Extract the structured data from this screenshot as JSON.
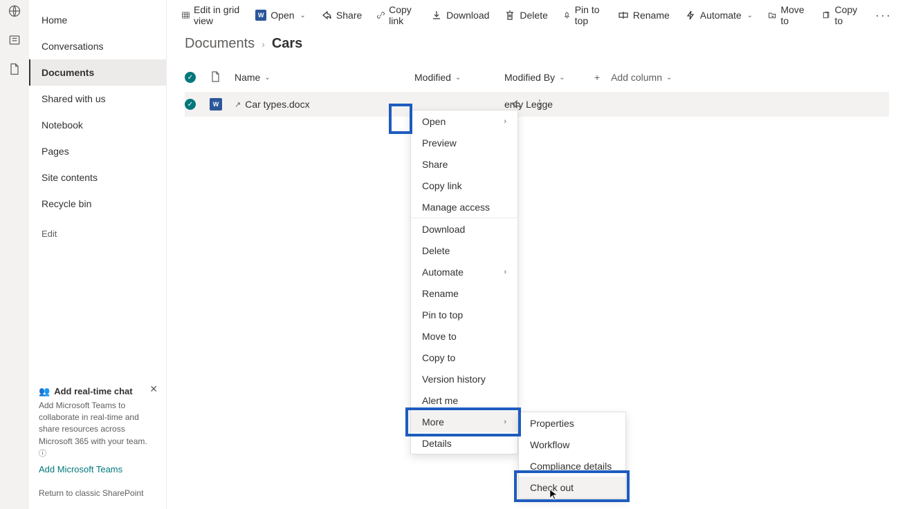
{
  "rail": {
    "items": [
      "globe-icon",
      "news-icon",
      "file-icon"
    ]
  },
  "sidebar": {
    "items": [
      {
        "label": "Home"
      },
      {
        "label": "Conversations"
      },
      {
        "label": "Documents"
      },
      {
        "label": "Shared with us"
      },
      {
        "label": "Notebook"
      },
      {
        "label": "Pages"
      },
      {
        "label": "Site contents"
      },
      {
        "label": "Recycle bin"
      }
    ],
    "edit_label": "Edit",
    "promo": {
      "title": "Add real-time chat",
      "desc": "Add Microsoft Teams to collaborate in real-time and share resources across Microsoft 365 with your team.",
      "link": "Add Microsoft Teams"
    },
    "return_link": "Return to classic SharePoint"
  },
  "toolbar": {
    "edit_grid": "Edit in grid view",
    "open": "Open",
    "share": "Share",
    "copy_link": "Copy link",
    "download": "Download",
    "delete": "Delete",
    "pin": "Pin to top",
    "rename": "Rename",
    "automate": "Automate",
    "move_to": "Move to",
    "copy_to": "Copy to"
  },
  "breadcrumb": {
    "parent": "Documents",
    "current": "Cars"
  },
  "columns": {
    "name": "Name",
    "modified": "Modified",
    "modified_by": "Modified By",
    "add": "Add column"
  },
  "row": {
    "filename": "Car types.docx",
    "modified_by": "enry Legge"
  },
  "ctx1": {
    "open": "Open",
    "preview": "Preview",
    "share": "Share",
    "copy_link": "Copy link",
    "manage_access": "Manage access",
    "download": "Download",
    "delete": "Delete",
    "automate": "Automate",
    "rename": "Rename",
    "pin": "Pin to top",
    "move_to": "Move to",
    "copy_to": "Copy to",
    "version_history": "Version history",
    "alert_me": "Alert me",
    "more": "More",
    "details": "Details"
  },
  "ctx2": {
    "properties": "Properties",
    "workflow": "Workflow",
    "compliance": "Compliance details",
    "check_out": "Check out"
  }
}
